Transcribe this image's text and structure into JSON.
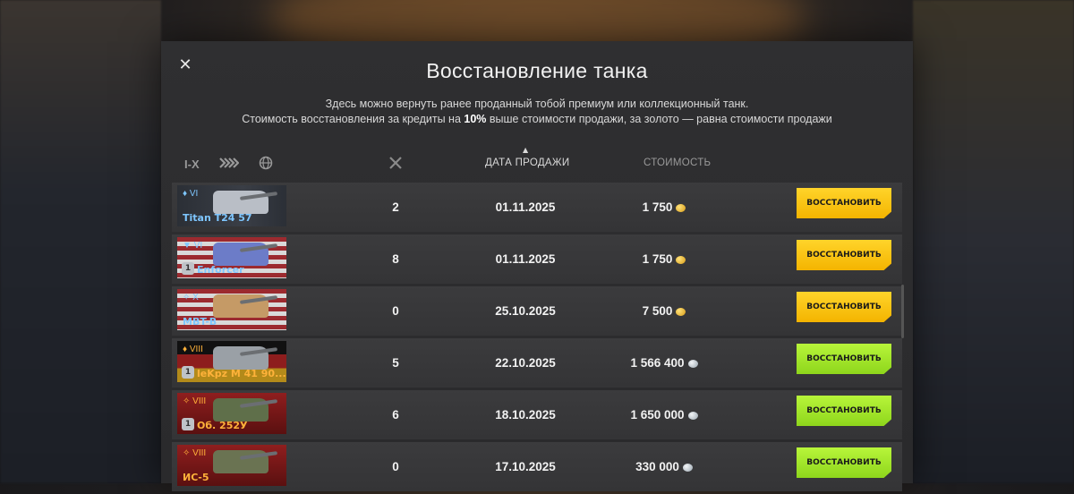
{
  "dialog": {
    "title": "Восстановление танка",
    "desc_line1": "Здесь можно вернуть ранее проданный тобой премиум или коллекционный танк.",
    "desc_line2_a": "Стоимость восстановления за кредиты на ",
    "desc_line2_bold": "10%",
    "desc_line2_b": " выше стоимости продажи, за золото — равна стоимости продажи",
    "close_icon": "close-icon"
  },
  "filters": {
    "tier": "I-X",
    "type_icon": "tank-type-icon",
    "nation_icon": "globe-icon"
  },
  "columns": {
    "battles_icon": "battles-crossed-swords-icon",
    "sale_date": "ДАТА ПРОДАЖИ",
    "cost": "СТОИМОСТЬ"
  },
  "rows": [
    {
      "tier": "♦ VI",
      "name": "Titan T24 57",
      "battles": "2",
      "date": "01.11.2025",
      "cost": "1 750",
      "currency": "gold",
      "button": "ВОССТАНОВИТЬ",
      "name_color": "#7ec6ff",
      "badge": ""
    },
    {
      "tier": "▼ VI",
      "name": "Enforcer",
      "battles": "8",
      "date": "01.11.2025",
      "cost": "1 750",
      "currency": "gold",
      "button": "ВОССТАНОВИТЬ",
      "name_color": "#7ec6ff",
      "badge": "1"
    },
    {
      "tier": "✧ X",
      "name": "MBT-B",
      "battles": "0",
      "date": "25.10.2025",
      "cost": "7 500",
      "currency": "gold",
      "button": "ВОССТАНОВИТЬ",
      "name_color": "#7ec6ff",
      "badge": ""
    },
    {
      "tier": "♦ VIII",
      "name": "leKpz M 41 90...",
      "battles": "5",
      "date": "22.10.2025",
      "cost": "1 566 400",
      "currency": "silver",
      "button": "ВОССТАНОВИТЬ",
      "name_color": "#ffb23a",
      "badge": "1"
    },
    {
      "tier": "✧ VIII",
      "name": "Об. 252У",
      "battles": "6",
      "date": "18.10.2025",
      "cost": "1 650 000",
      "currency": "silver",
      "button": "ВОССТАНОВИТЬ",
      "name_color": "#ffb23a",
      "badge": "1"
    },
    {
      "tier": "✧ VIII",
      "name": "ИС-5",
      "battles": "0",
      "date": "17.10.2025",
      "cost": "330 000",
      "currency": "silver",
      "button": "ВОССТАНОВИТЬ",
      "name_color": "#ffb23a",
      "badge": ""
    }
  ]
}
